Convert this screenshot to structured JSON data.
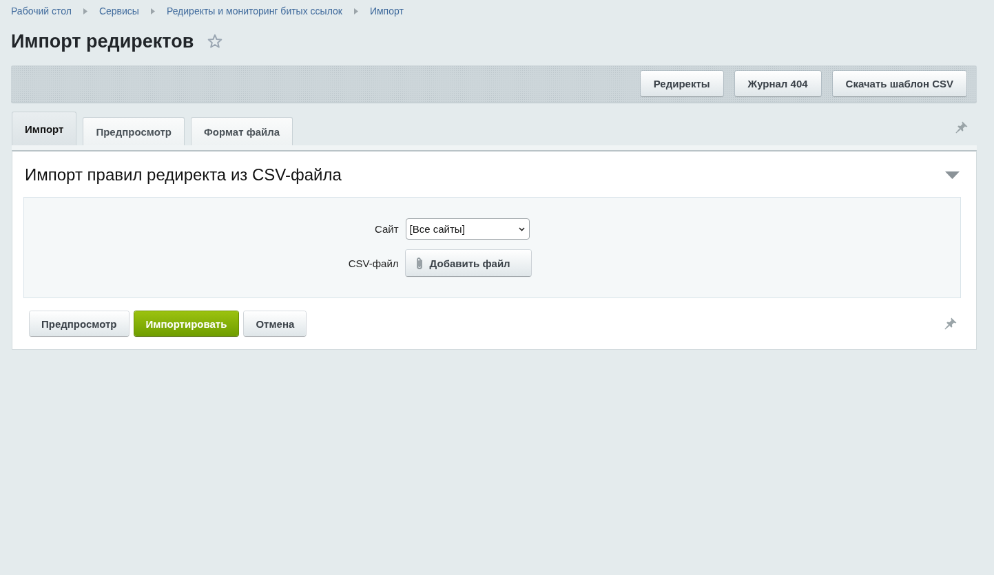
{
  "breadcrumbs": [
    {
      "label": "Рабочий стол"
    },
    {
      "label": "Сервисы"
    },
    {
      "label": "Редиректы и мониторинг битых ссылок"
    },
    {
      "label": "Импорт"
    }
  ],
  "page_title": "Импорт редиректов",
  "favorite": false,
  "toolbar_buttons": [
    "Редиректы",
    "Журнал 404",
    "Скачать шаблон CSV"
  ],
  "tabs": [
    {
      "label": "Импорт",
      "selected": true
    },
    {
      "label": "Предпросмотр",
      "selected": false
    },
    {
      "label": "Формат файла",
      "selected": false
    }
  ],
  "section": {
    "title": "Импорт правил редиректа из CSV-файла",
    "expanded": true,
    "fields": [
      {
        "kind": "select",
        "label": "Сайт",
        "value": "[Все сайты]"
      },
      {
        "kind": "file",
        "label": "CSV-файл",
        "button": "Добавить файл"
      }
    ]
  },
  "actions": [
    {
      "label": "Предпросмотр",
      "kind": "default"
    },
    {
      "label": "Импортировать",
      "kind": "primary"
    },
    {
      "label": "Отмена",
      "kind": "default"
    }
  ]
}
